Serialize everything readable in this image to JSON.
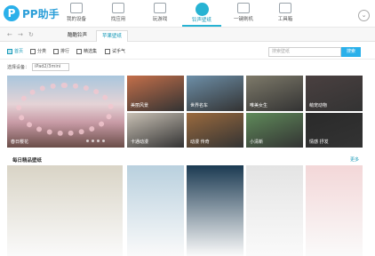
{
  "app": {
    "logo_mark": "P",
    "logo_text": "PP助手"
  },
  "nav": [
    {
      "label": "我的设备",
      "active": false
    },
    {
      "label": "找应用",
      "active": false
    },
    {
      "label": "玩游戏",
      "active": false
    },
    {
      "label": "铃声壁纸",
      "active": true
    },
    {
      "label": "一键刷机",
      "active": false
    },
    {
      "label": "工具箱",
      "active": false
    }
  ],
  "tabs": [
    {
      "label": "酷酷铃声",
      "active": false
    },
    {
      "label": "苹果壁纸",
      "active": true
    }
  ],
  "toolbar": {
    "items": [
      {
        "label": "首页",
        "active": true
      },
      {
        "label": "分类",
        "active": false
      },
      {
        "label": "排行",
        "active": false
      },
      {
        "label": "精选集",
        "active": false
      },
      {
        "label": "试手气",
        "active": false
      }
    ],
    "search_placeholder": "搜索壁纸",
    "search_button": "搜索"
  },
  "device": {
    "label": "选择设备：",
    "value": "iPad2/3mini"
  },
  "featured": {
    "big_caption": "春日樱花",
    "tiles": [
      {
        "caption": "美丽风景",
        "color": "#c46f4a"
      },
      {
        "caption": "世界名车",
        "color": "#6d8fa8"
      },
      {
        "caption": "唯美女生",
        "color": "#7e7a6a"
      },
      {
        "caption": "萌宠动物",
        "color": "#4a4040"
      },
      {
        "caption": "卡通动漫",
        "color": "#c8c0b4"
      },
      {
        "caption": "动漫 传奇",
        "color": "#9a6a3e"
      },
      {
        "caption": "小清新",
        "color": "#5f8a5a"
      },
      {
        "caption": "情感 抒发",
        "color": "#2a2a2a"
      }
    ]
  },
  "daily": {
    "title": "每日精品壁纸",
    "more": "更多",
    "tiles": [
      {
        "color": "#d9d4c6"
      },
      {
        "color": "#b9d0de"
      },
      {
        "color": "#1b3a52"
      },
      {
        "color": "#e4e4e4"
      },
      {
        "color": "#f3d7d8"
      },
      {
        "color": "#c98a4f"
      }
    ]
  }
}
